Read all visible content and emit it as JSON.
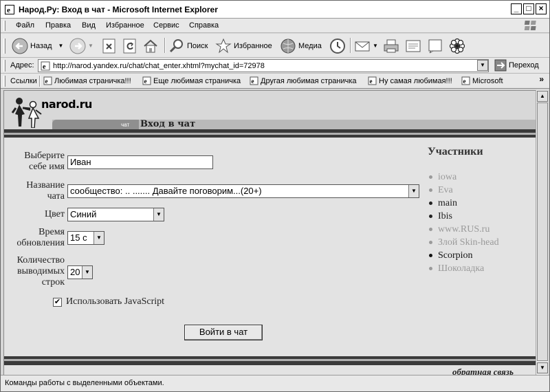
{
  "window": {
    "title": "Народ.Ру: Вход в чат - Microsoft Internet Explorer",
    "controls": {
      "minimize": "_",
      "maximize": "□",
      "close": "×"
    }
  },
  "menu": {
    "items": [
      {
        "label": "Файл"
      },
      {
        "label": "Правка"
      },
      {
        "label": "Вид"
      },
      {
        "label": "Избранное"
      },
      {
        "label": "Сервис"
      },
      {
        "label": "Справка"
      }
    ]
  },
  "toolbar": {
    "back_label": "Назад",
    "search_label": "Поиск",
    "favorites_label": "Избранное",
    "media_label": "Медиа"
  },
  "address": {
    "label": "Адрес:",
    "url": "http://narod.yandex.ru/chat/chat_enter.xhtml?mychat_id=72978",
    "go_label": "Переход"
  },
  "links": {
    "label": "Ссылки",
    "items": [
      {
        "label": "Любимая страничка!!!"
      },
      {
        "label": "Еще любимая страничка"
      },
      {
        "label": "Другая любимая страничка"
      },
      {
        "label": "Ну самая любимая!!!"
      },
      {
        "label": "Microsoft"
      }
    ],
    "more": "»"
  },
  "site": {
    "logo": "narod.ru",
    "tab_small": "чат",
    "tab_title": "Вход в чат"
  },
  "form": {
    "name_label": "Выберите себе имя",
    "name_value": "Иван",
    "chat_label": "Название чата",
    "chat_value": "сообщество: .. ....... Давайте поговорим...(20+)",
    "color_label": "Цвет",
    "color_value": "Синий",
    "refresh_label": "Время обновления",
    "refresh_value": "15 с",
    "rows_label": "Количество выводимых строк",
    "rows_value": "20",
    "js_label": "Использовать JavaScript",
    "js_checked": "✔",
    "submit_label": "Войти в чат"
  },
  "participants": {
    "title": "Участники",
    "items": [
      {
        "name": "iowa",
        "color": "#9a9a9a"
      },
      {
        "name": "Eva",
        "color": "#9a9a9a"
      },
      {
        "name": "main",
        "color": "#222222"
      },
      {
        "name": "Ibis",
        "color": "#222222"
      },
      {
        "name": "www.RUS.ru",
        "color": "#9a9a9a"
      },
      {
        "name": "Злой Skin-head",
        "color": "#9a9a9a"
      },
      {
        "name": "Scorpion",
        "color": "#111111"
      },
      {
        "name": "Шоколадка",
        "color": "#9a9a9a"
      }
    ]
  },
  "footer": {
    "feedback": "обратная связь"
  },
  "status": {
    "text": "Команды работы с выделенными объектами."
  }
}
